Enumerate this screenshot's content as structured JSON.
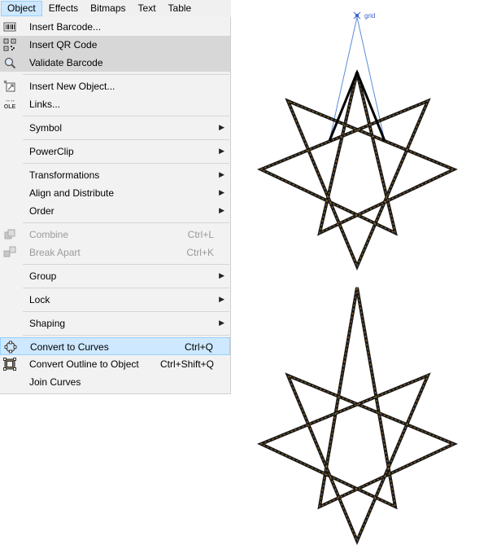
{
  "menubar": {
    "items": [
      {
        "label": "Object",
        "active": true
      },
      {
        "label": "Effects",
        "active": false
      },
      {
        "label": "Bitmaps",
        "active": false
      },
      {
        "label": "Text",
        "active": false
      },
      {
        "label": "Table",
        "active": false
      }
    ]
  },
  "menu": {
    "items": [
      {
        "label": "Insert Barcode...",
        "icon": "barcode-icon",
        "state": "normal"
      },
      {
        "label": "Insert QR Code",
        "icon": "qr-code-icon",
        "state": "highlighted"
      },
      {
        "label": "Validate Barcode",
        "icon": "magnifier-icon",
        "state": "highlighted"
      },
      {
        "label": "Insert New Object...",
        "icon": "new-object-icon",
        "state": "normal"
      },
      {
        "label": "Links...",
        "icon": "ole-icon",
        "icon_text": "OLE",
        "state": "normal"
      },
      {
        "label": "Symbol",
        "submenu": true
      },
      {
        "label": "PowerClip",
        "submenu": true
      },
      {
        "label": "Transformations",
        "submenu": true
      },
      {
        "label": "Align and Distribute",
        "submenu": true
      },
      {
        "label": "Order",
        "submenu": true
      },
      {
        "label": "Combine",
        "shortcut": "Ctrl+L",
        "icon": "combine-icon",
        "state": "disabled"
      },
      {
        "label": "Break Apart",
        "shortcut": "Ctrl+K",
        "icon": "break-apart-icon",
        "state": "disabled"
      },
      {
        "label": "Group",
        "submenu": true
      },
      {
        "label": "Lock",
        "submenu": true
      },
      {
        "label": "Shaping",
        "submenu": true
      },
      {
        "label": "Convert to Curves",
        "shortcut": "Ctrl+Q",
        "icon": "convert-curves-icon",
        "state": "selected"
      },
      {
        "label": "Convert Outline to Object",
        "shortcut": "Ctrl+Shift+Q",
        "icon": "convert-outline-icon",
        "state": "normal"
      },
      {
        "label": "Join Curves",
        "state": "normal"
      }
    ]
  },
  "canvas": {
    "snap_label": "grid",
    "guide_color": "#5b8bd9",
    "star_outline_color": "#1a1a1a",
    "star_dash_color": "#b07a2a"
  }
}
